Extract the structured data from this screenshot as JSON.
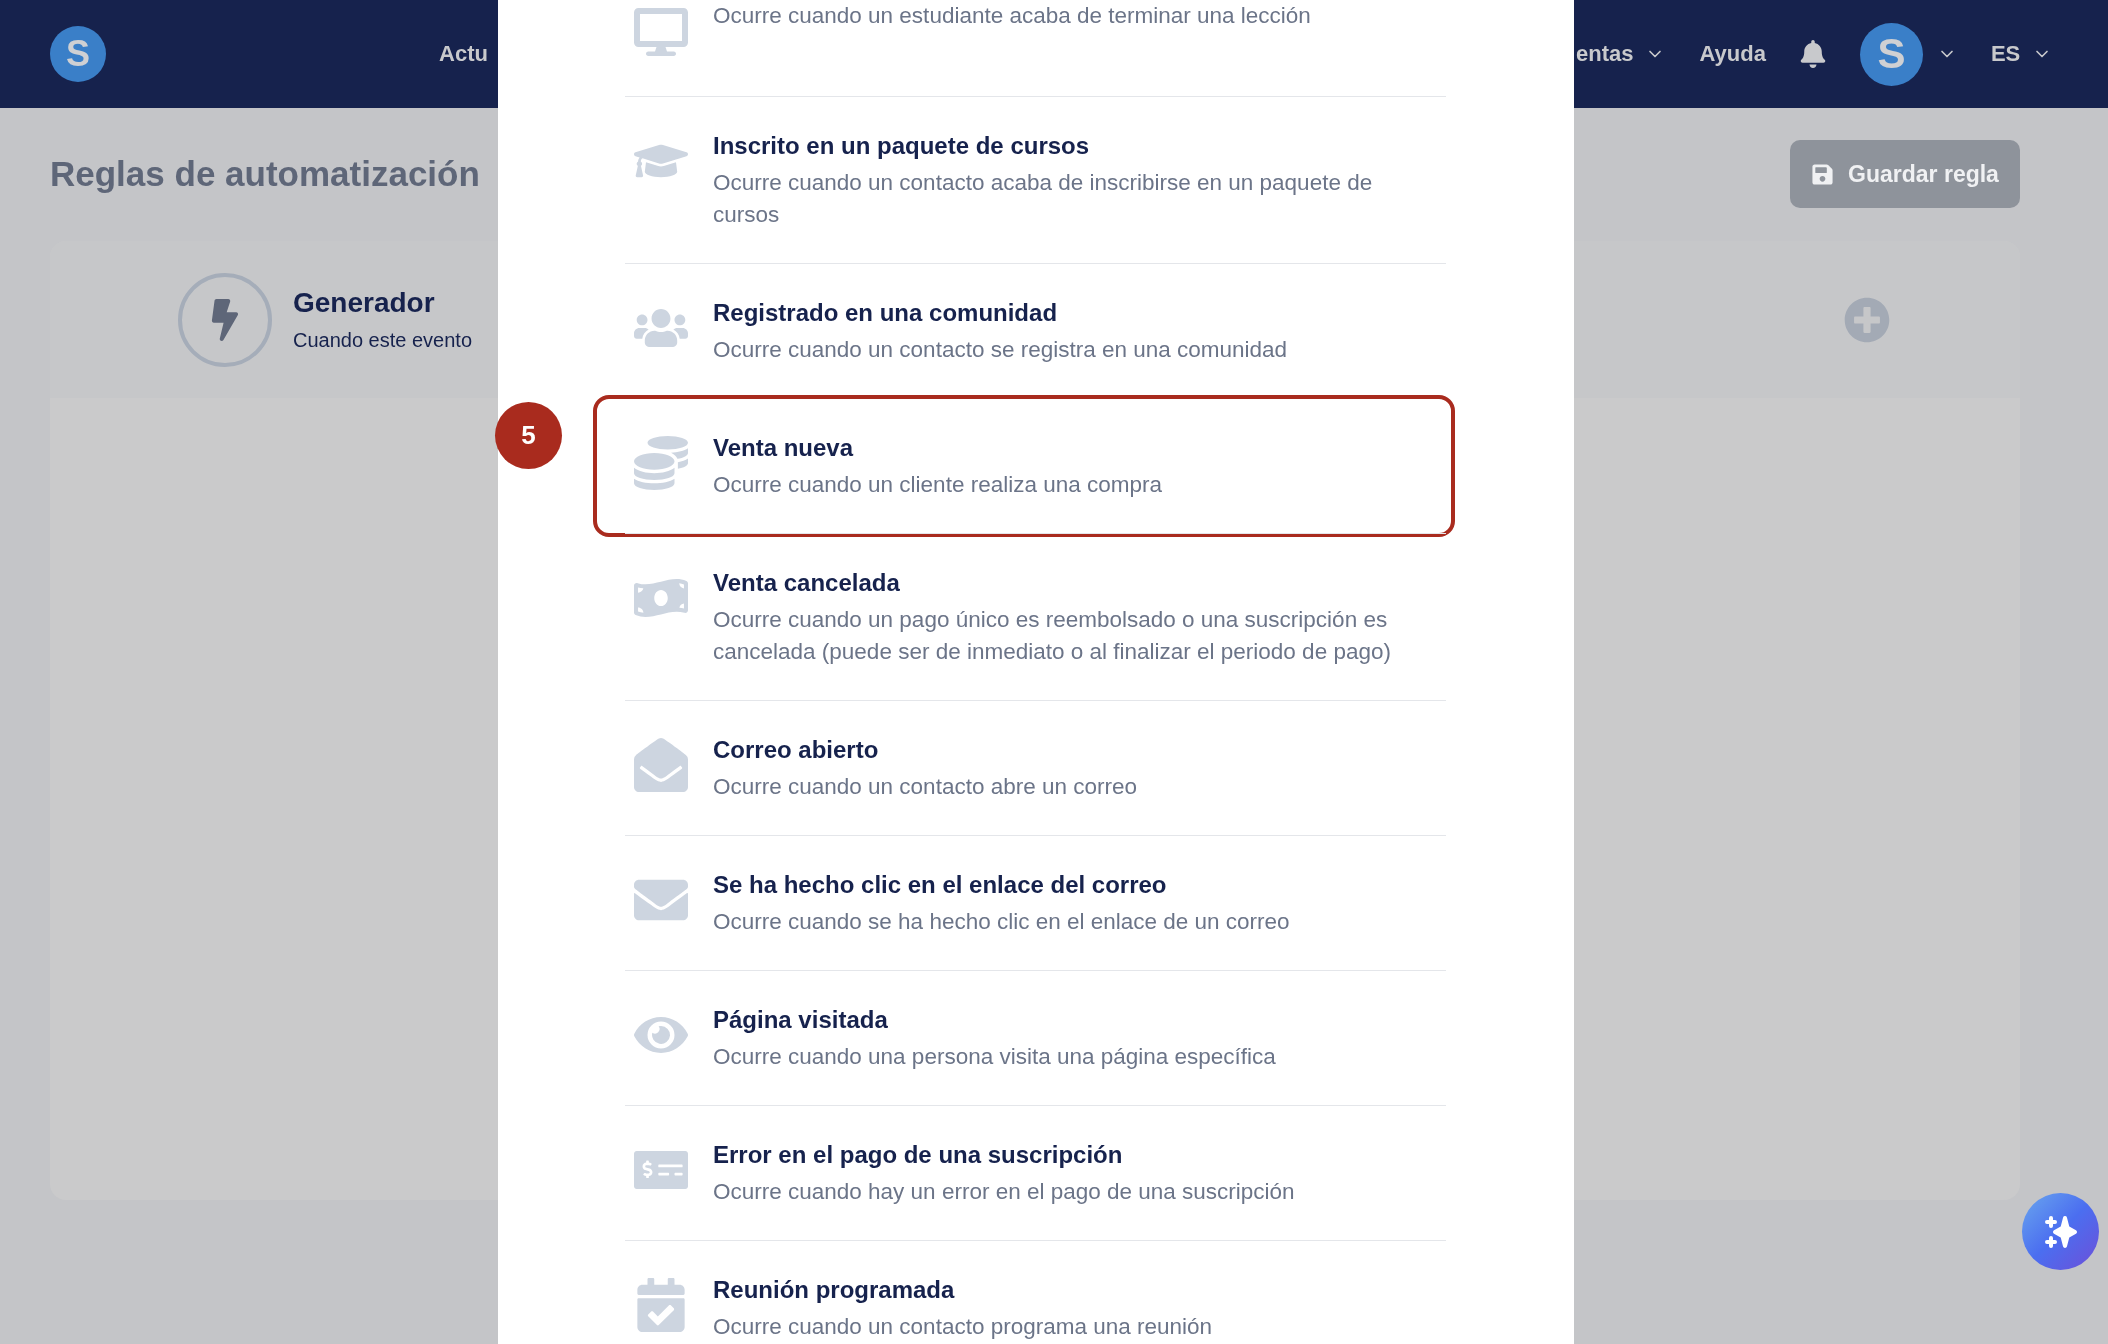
{
  "header": {
    "logo": "S",
    "nav_left": [
      {
        "label": "Actu"
      }
    ],
    "nav_right": [
      {
        "label": "entas",
        "dropdown": true
      },
      {
        "label": "Ayuda",
        "dropdown": false
      }
    ],
    "avatar": "S",
    "language": "ES"
  },
  "page": {
    "title": "Reglas de automatización",
    "save_button": {
      "label": "Guardar regla",
      "disabled": true
    }
  },
  "trigger_card": {
    "title": "Generador",
    "subtitle": "Cuando este evento"
  },
  "modal": {
    "step_badge": "5",
    "events": [
      {
        "kind": "monitor",
        "description": "Ocurre cuando un estudiante acaba de terminar una lección",
        "selected": false
      },
      {
        "kind": "graduation",
        "title": "Inscrito en un paquete de cursos",
        "description": "Ocurre cuando un contacto acaba de inscribirse en un paquete de cursos",
        "selected": false
      },
      {
        "kind": "community",
        "title": "Registrado en una comunidad",
        "description": "Ocurre cuando un contacto se registra en una comunidad",
        "selected": false
      },
      {
        "kind": "coins",
        "title": "Venta nueva",
        "description": "Ocurre cuando un cliente realiza una compra",
        "selected": true
      },
      {
        "kind": "refund",
        "title": "Venta cancelada",
        "description": "Ocurre cuando un pago único es reembolsado o una suscripción es cancelada (puede ser de inmediato o al finalizar el periodo de pago)",
        "selected": false
      },
      {
        "kind": "envelope_open",
        "title": "Correo abierto",
        "description": "Ocurre cuando un contacto abre un correo",
        "selected": false
      },
      {
        "kind": "envelope_click",
        "title": "Se ha hecho clic en el enlace del correo",
        "description": "Ocurre cuando se ha hecho clic en el enlace de un correo",
        "selected": false
      },
      {
        "kind": "eye",
        "title": "Página visitada",
        "description": "Ocurre cuando una persona visita una página específica",
        "selected": false
      },
      {
        "kind": "payment_error",
        "title": "Error en el pago de una suscripción",
        "description": "Ocurre cuando hay un error en el pago de una suscripción",
        "selected": false
      },
      {
        "kind": "calendar",
        "title": "Reunión programada",
        "description": "Ocurre cuando un contacto programa una reunión",
        "selected": false
      }
    ]
  }
}
